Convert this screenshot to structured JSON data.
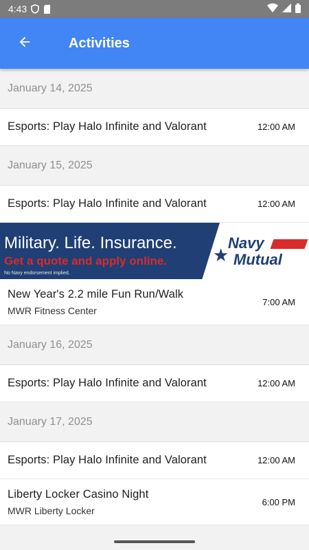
{
  "status_bar": {
    "time": "4:43",
    "icons": [
      "shield-icon",
      "sd-card-icon",
      "wifi-icon",
      "signal-icon",
      "battery-icon"
    ]
  },
  "app_bar": {
    "title": "Activities",
    "back_icon": "arrow-left-icon",
    "color": "#4285f4"
  },
  "sections": [
    {
      "date": "January 14, 2025",
      "events": [
        {
          "name": "Esports: Play Halo Infinite and Valorant",
          "time": "12:00 AM"
        }
      ]
    },
    {
      "date": "January 15, 2025",
      "events": [
        {
          "name": "Esports: Play Halo Infinite and Valorant",
          "time": "12:00 AM"
        },
        {
          "name": "New Year's 2.2 mile Fun Run/Walk",
          "location": "MWR Fitness Center",
          "time": "7:00 AM"
        }
      ]
    },
    {
      "date": "January 16, 2025",
      "events": [
        {
          "name": "Esports: Play Halo Infinite and Valorant",
          "time": "12:00 AM"
        }
      ]
    },
    {
      "date": "January 17, 2025",
      "events": [
        {
          "name": "Esports: Play Halo Infinite and Valorant",
          "time": "12:00 AM"
        },
        {
          "name": "Liberty Locker Casino Night",
          "location": "MWR Liberty Locker",
          "time": "6:00 PM"
        }
      ]
    }
  ],
  "ad": {
    "headline": "Military. Life. Insurance.",
    "cta": "Get a quote and apply online.",
    "disclaimer": "No Navy endorsement implied.",
    "brand_line1": "Navy",
    "brand_line2": "Mutual",
    "colors": {
      "navy": "#1f3f75",
      "red": "#d92b2b"
    }
  }
}
